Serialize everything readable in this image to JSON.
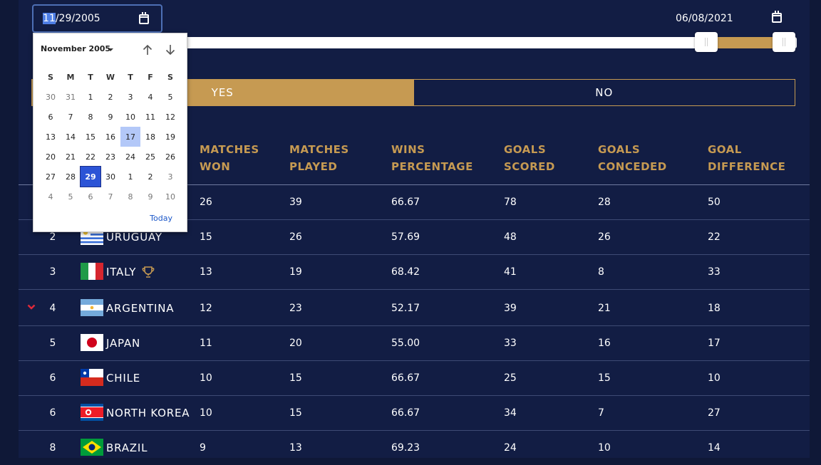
{
  "filters": {
    "date_start": {
      "month": "11",
      "rest": "/29/2005"
    },
    "date_end": "06/08/2021",
    "toggle": {
      "yes": "Yes",
      "no": "No"
    }
  },
  "calendar": {
    "title": "November 2005",
    "weekdays": [
      "S",
      "M",
      "T",
      "W",
      "T",
      "F",
      "S"
    ],
    "days": [
      "30",
      "31",
      "1",
      "2",
      "3",
      "4",
      "5",
      "6",
      "7",
      "8",
      "9",
      "10",
      "11",
      "12",
      "13",
      "14",
      "15",
      "16",
      "17",
      "18",
      "19",
      "20",
      "21",
      "22",
      "23",
      "24",
      "25",
      "26",
      "27",
      "28",
      "29",
      "30",
      "1",
      "2",
      "3",
      "4",
      "5",
      "6",
      "7",
      "8",
      "9",
      "10"
    ],
    "today_label": "Today"
  },
  "table": {
    "headers": {
      "won": [
        "Matches",
        "won"
      ],
      "played": [
        "Matches",
        "played"
      ],
      "pct": [
        "wins",
        "percentage"
      ],
      "scored": [
        "goals",
        "scored"
      ],
      "conceded": [
        "goals",
        "conceded"
      ],
      "diff": [
        "goal",
        "difference"
      ]
    },
    "rows": [
      {
        "rank": "",
        "country": "",
        "won": "26",
        "played": "39",
        "pct": "66.67",
        "scored": "78",
        "conceded": "28",
        "diff": "50"
      },
      {
        "rank": "2",
        "country": "Uruguay",
        "won": "15",
        "played": "26",
        "pct": "57.69",
        "scored": "48",
        "conceded": "26",
        "diff": "22"
      },
      {
        "rank": "3",
        "country": "Italy",
        "won": "13",
        "played": "19",
        "pct": "68.42",
        "scored": "41",
        "conceded": "8",
        "diff": "33"
      },
      {
        "rank": "4",
        "country": "Argentina",
        "won": "12",
        "played": "23",
        "pct": "52.17",
        "scored": "39",
        "conceded": "21",
        "diff": "18"
      },
      {
        "rank": "5",
        "country": "Japan",
        "won": "11",
        "played": "20",
        "pct": "55.00",
        "scored": "33",
        "conceded": "16",
        "diff": "17"
      },
      {
        "rank": "6",
        "country": "Chile",
        "won": "10",
        "played": "15",
        "pct": "66.67",
        "scored": "25",
        "conceded": "15",
        "diff": "10"
      },
      {
        "rank": "6",
        "country": "North Korea",
        "won": "10",
        "played": "15",
        "pct": "66.67",
        "scored": "34",
        "conceded": "7",
        "diff": "27"
      },
      {
        "rank": "8",
        "country": "Brazil",
        "won": "9",
        "played": "13",
        "pct": "69.23",
        "scored": "24",
        "conceded": "10",
        "diff": "14"
      }
    ]
  },
  "colors": {
    "accent": "#c69a52",
    "background": "#121d44",
    "selected_day": "#2c54d6"
  }
}
